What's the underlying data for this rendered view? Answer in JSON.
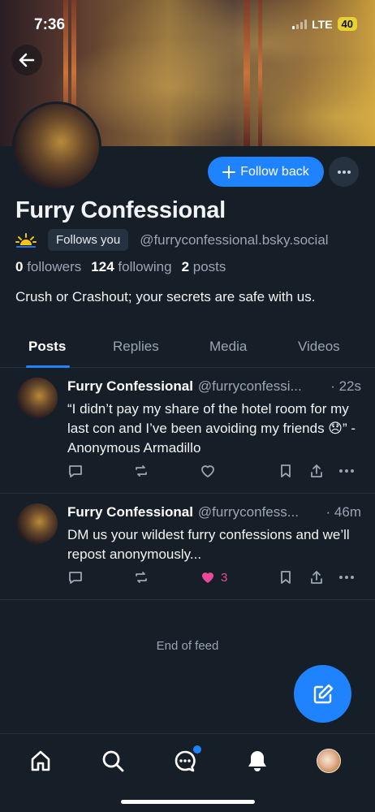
{
  "status_bar": {
    "time": "7:36",
    "network": "LTE",
    "battery": "40"
  },
  "profile": {
    "display_name": "Furry Confessional",
    "follows_you": "Follows you",
    "handle": "@furryconfessional.bsky.social",
    "followers_count": "0",
    "followers_label": "followers",
    "following_count": "124",
    "following_label": "following",
    "posts_count": "2",
    "posts_label": "posts",
    "bio": "Crush or Crashout; your secrets are safe with us.",
    "follow_back_label": "Follow back"
  },
  "tabs": [
    {
      "label": "Posts",
      "active": true
    },
    {
      "label": "Replies",
      "active": false
    },
    {
      "label": "Media",
      "active": false
    },
    {
      "label": "Videos",
      "active": false
    }
  ],
  "posts": [
    {
      "author": "Furry Confessional",
      "handle": "@furryconfessi...",
      "time": "· 22s",
      "text": "“I didn’t pay my share of the hotel room for my last con and I’ve been avoiding my friends 😞” -Anonymous Armadillo",
      "likes": ""
    },
    {
      "author": "Furry Confessional",
      "handle": "@furryconfess...",
      "time": "· 46m",
      "text": "DM us your wildest furry confessions and we’ll repost anonymously...",
      "likes": "3"
    }
  ],
  "feed_end": "End of feed",
  "colors": {
    "accent": "#1f83ff",
    "like": "#ec4899",
    "background": "#161e27"
  },
  "icons": [
    "back-arrow-icon",
    "plus-icon",
    "ellipsis-icon",
    "reply-icon",
    "repost-icon",
    "heart-icon",
    "bookmark-icon",
    "share-icon",
    "compose-icon",
    "home-icon",
    "search-icon",
    "chat-icon",
    "bell-icon"
  ]
}
